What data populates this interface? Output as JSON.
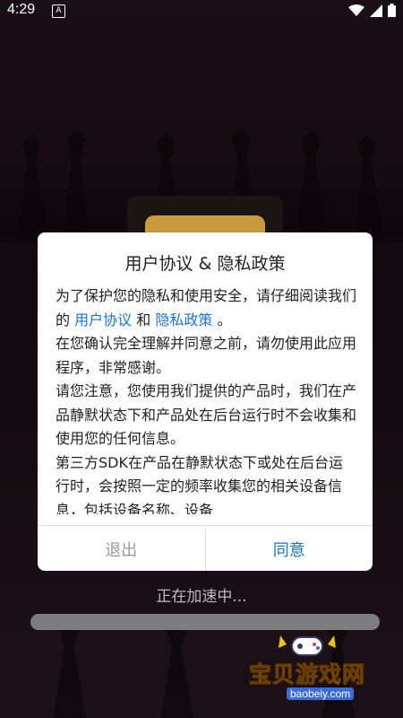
{
  "status_bar": {
    "time": "4:29",
    "notification_icon": "A"
  },
  "dialog": {
    "title": "用户协议 & 隐私政策",
    "body": {
      "line1": "为了保护您的隐私和使用安全，请仔细阅读我们的",
      "link_user_agreement": "用户协议",
      "and": "和",
      "link_privacy_policy": "隐私政策",
      "period": "。",
      "p2": "在您确认完全理解并同意之前，请勿使用此应用程序，非常感谢。",
      "p3": "请您注意，您使用我们提供的产品时，我们在产品静默状态下和产品处在后台运行时不会收集和使用您的任何信息。",
      "p4": "第三方SDK在产品在静默状态下或处在后台运行时，会按照一定的频率收集您的相关设备信息，包括设备名称、设备"
    },
    "buttons": {
      "exit": "退出",
      "agree": "同意"
    }
  },
  "loading": {
    "text": "正在加速中...",
    "progress": 0.0
  },
  "watermark": {
    "text": "宝贝游戏网",
    "url": "baobeiy.com"
  },
  "colors": {
    "link": "#1a73d6",
    "agree": "#1a73d6",
    "exit": "#999999",
    "watermark": "#f2c200"
  }
}
